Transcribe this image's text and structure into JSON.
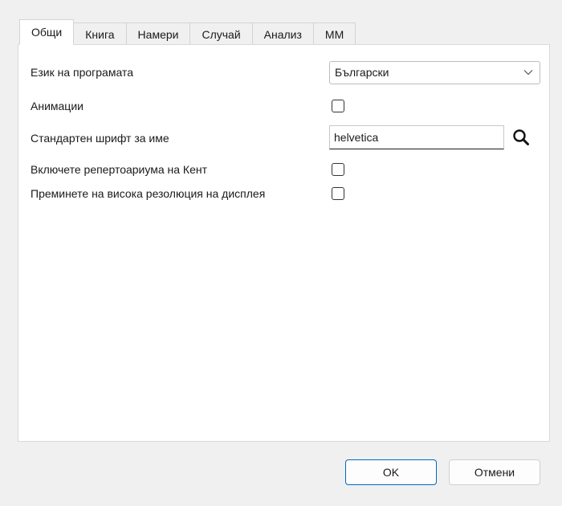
{
  "tabs": [
    {
      "label": "Общи",
      "active": true
    },
    {
      "label": "Книга",
      "active": false
    },
    {
      "label": "Намери",
      "active": false
    },
    {
      "label": "Случай",
      "active": false
    },
    {
      "label": "Анализ",
      "active": false
    },
    {
      "label": "ММ",
      "active": false
    }
  ],
  "general": {
    "language_label": "Език на програмата",
    "language_value": "Български",
    "animations_label": "Анимации",
    "animations_checked": false,
    "font_label": "Стандартен шрифт за име",
    "font_value": "helvetica",
    "kent_label": "Включете репертоариума на Кент",
    "kent_checked": false,
    "hires_label": "Преминете на висока резолюция на дисплея",
    "hires_checked": false
  },
  "icons": {
    "search": "search-icon",
    "dropdown": "chevron-down-icon"
  },
  "buttons": {
    "ok": "OK",
    "cancel": "Отмени"
  },
  "colors": {
    "accent": "#0067c0"
  }
}
